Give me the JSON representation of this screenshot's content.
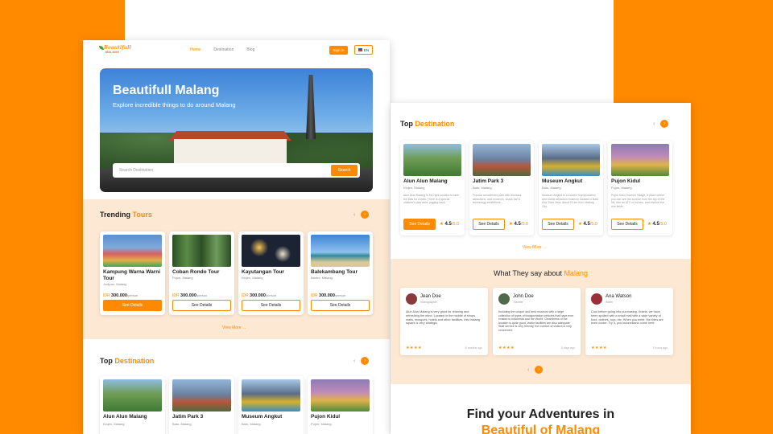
{
  "nav": {
    "links": [
      "Home",
      "Destination",
      "Blog"
    ],
    "signin": "Sign In",
    "lang": "EN",
    "logo_top": "Beautifull",
    "logo_bottom": "MALANG"
  },
  "hero": {
    "title": "Beautifull Malang",
    "subtitle": "Explore incredible things to do around Malang",
    "search_placeholder": "Search Destination",
    "search_button": "Search"
  },
  "trending": {
    "title_a": "Trending",
    "title_b": "Tours",
    "view_more": "View More →",
    "cards": [
      {
        "name": "Kampung Warna Warni Tour",
        "loc": "Jodipan, Malang",
        "price_cur": "IDR",
        "price": "300.000",
        "per": "/person",
        "button": "See Details",
        "primary": true,
        "img": "#5b8fd0"
      },
      {
        "name": "Coban Rondo Tour",
        "loc": "Pujon, Malang",
        "price_cur": "IDR",
        "price": "300.000",
        "per": "/person",
        "button": "See Details",
        "primary": false,
        "img": "#3f6d33"
      },
      {
        "name": "Kayutangan Tour",
        "loc": "Klojen, Malang",
        "price_cur": "IDR",
        "price": "300.000",
        "per": "/person",
        "button": "See Details",
        "primary": false,
        "img": "#1c2333"
      },
      {
        "name": "Balekambang Tour",
        "loc": "Bantur, Malang",
        "price_cur": "IDR",
        "price": "300.000",
        "per": "/person",
        "button": "See Details",
        "primary": false,
        "img": "#3e84d6"
      }
    ]
  },
  "top_dest": {
    "title_a": "Top",
    "title_b": "Destination",
    "cards": [
      {
        "name": "Alun Alun Malang",
        "loc": "Klojen, Malang",
        "img": "#4f8a3c"
      },
      {
        "name": "Jatim Park 3",
        "loc": "Batu, Malang",
        "img": "#6b7f9c"
      },
      {
        "name": "Museum Angkut",
        "loc": "Batu, Malang",
        "img": "#5a6d88"
      },
      {
        "name": "Pujon Kidul",
        "loc": "Pujon, Malang",
        "img": "#8a7db2"
      }
    ]
  },
  "top_dest2": {
    "title_a": "Top",
    "title_b": "Destination",
    "view_more": "View More →",
    "cards": [
      {
        "name": "Alun Alun Malang",
        "loc": "Klojen, Malang",
        "desc": "Alun Alun Malang is the right location to take the kids for a walk. There is a special children's play area, jogging track...",
        "button": "See Details",
        "primary": true,
        "rating": "4.5",
        "max": "/5.0",
        "img": "#4f8a3c"
      },
      {
        "name": "Jatim Park 3",
        "loc": "Batu, Malang",
        "desc": "Popular amusement park with dinosaur attractions, wax museum, snack bar & technology exhibitions...",
        "button": "See Details",
        "primary": false,
        "rating": "4.5",
        "max": "/5.0",
        "img": "#6b7f9c"
      },
      {
        "name": "Museum Angkut",
        "loc": "Batu, Malang",
        "desc": "Museum Angkut is a modern transportation and tourist attraction museum located in Batu City, East Java, about 20 km from Malang City.",
        "button": "See Details",
        "primary": false,
        "rating": "4.5",
        "max": "/5.0",
        "img": "#5a6d88"
      },
      {
        "name": "Pujon Kidul",
        "loc": "Pujon, Malang",
        "desc": "Pujon Kidul Tourism Village, a place where you can see the sunrise from the top of the hill, ride an ATV or horses, and explore the rice fields.",
        "button": "See Details",
        "primary": false,
        "rating": "4.5",
        "max": "/5.0",
        "img": "#8a7db2"
      }
    ]
  },
  "testimonials": {
    "title_a": "What They say about",
    "title_b": "Malang",
    "items": [
      {
        "name": "Jean Doe",
        "role": "Videographer",
        "text": "Alun Alun Malang is very good for relaxing and refreshing the mind. Located in the middle of shops, malls, mosques, hotels and other facilities, this Malang square is very strategic.",
        "stars": "★★★★",
        "time": "6 months ago",
        "avatar": "#8a3a3a"
      },
      {
        "name": "John Doe",
        "role": "Traveler",
        "text": "Including the unique and best museum with a large collection of types of transportation vehicles that have ever existed in Indonesia and the World. Cleanliness of the location is quite good, visitor facilities are also adequate. Staff service is very friendly, the comfort of visitors is very concerned.",
        "stars": "★★★★",
        "time": "5 days ago",
        "avatar": "#4f6a4a"
      },
      {
        "name": "Ana Watson",
        "role": "Writer",
        "text": "Cool before going into purchasing, tickets, we have been spoiled with a small mall with a wide variety of food, clothes, toys, etc. When you enter, the rides are even cooler. Try it, you Indonesians come here.",
        "stars": "★★★★",
        "time": "7 hours ago",
        "avatar": "#9a2f3a"
      }
    ]
  },
  "find": {
    "line1": "Find your Adventures in",
    "line2": "Beautiful of Malang"
  },
  "colors": {
    "accent": "#ff8a00",
    "peach": "#fde8d3"
  }
}
